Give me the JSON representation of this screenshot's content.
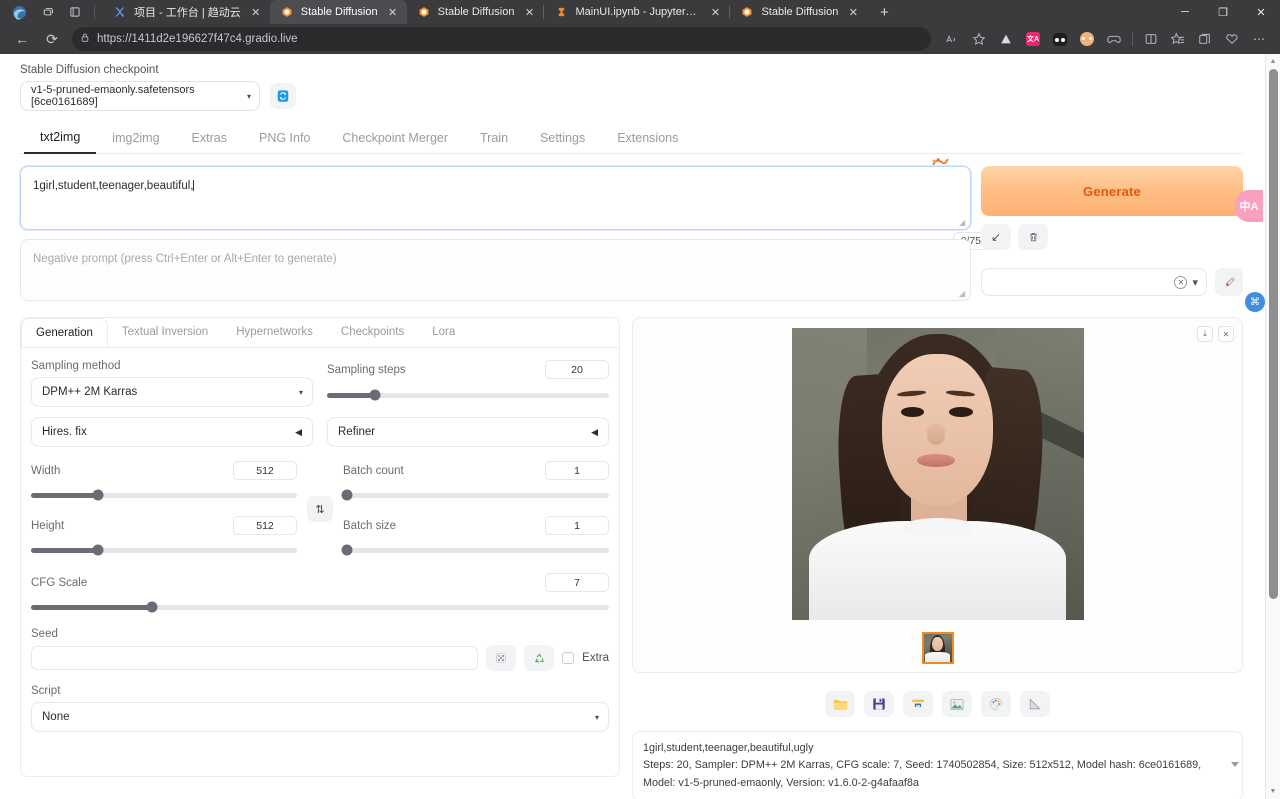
{
  "browser": {
    "tabs": [
      {
        "title": "项目 - 工作台 | 趋动云",
        "favicon": "x-logo-icon",
        "active": false
      },
      {
        "title": "Stable Diffusion",
        "favicon": "sd-icon",
        "active": true
      },
      {
        "title": "Stable Diffusion",
        "favicon": "sd-icon",
        "active": false
      },
      {
        "title": "MainUI.ipynb - JupyterLab",
        "favicon": "hourglass-icon",
        "active": false
      },
      {
        "title": "Stable Diffusion",
        "favicon": "sd-icon",
        "active": false
      }
    ],
    "tab_close_label": "✕",
    "new_tab_label": "+",
    "window_controls": {
      "minimize": "─",
      "maximize": "❐",
      "close": "✕"
    },
    "nav": {
      "back": "←",
      "reload": "⟳"
    },
    "address": {
      "lock": "🔒",
      "url": "https://1411d2e196627f47c4.gradio.live"
    },
    "toolbar_icons": [
      "read-aloud-icon",
      "favorite-star-icon",
      "split-screen-icon",
      "translate-icon",
      "panda-icon",
      "profile-icon",
      "games-icon",
      "split-pane-icon",
      "collections-icon",
      "browser-essentials-icon",
      "drop-favorites-icon",
      "more-options-icon"
    ]
  },
  "checkpoint": {
    "label": "Stable Diffusion checkpoint",
    "value": "v1-5-pruned-emaonly.safetensors [6ce0161689]",
    "caret": "▾",
    "refresh_icon": "🔄"
  },
  "main_tabs": [
    {
      "label": "txt2img",
      "active": true
    },
    {
      "label": "img2img",
      "active": false
    },
    {
      "label": "Extras",
      "active": false
    },
    {
      "label": "PNG Info",
      "active": false
    },
    {
      "label": "Checkpoint Merger",
      "active": false
    },
    {
      "label": "Train",
      "active": false
    },
    {
      "label": "Settings",
      "active": false
    },
    {
      "label": "Extensions",
      "active": false
    }
  ],
  "prompt": {
    "positive_value": "1girl,student,teenager,beautiful,",
    "negative_placeholder": "Negative prompt (press Ctrl+Enter or Alt+Enter to generate)",
    "token_counter": "0/75",
    "paint_icon": "🎨"
  },
  "actions": {
    "generate_label": "Generate",
    "arrow_button": "↙",
    "trash_button": "🗑",
    "styles_clear": "✕",
    "styles_caret": "▾",
    "brush_button": "🖌",
    "translate_badge": "中A",
    "blue_circle": "⌘"
  },
  "sub_tabs": [
    {
      "label": "Generation",
      "active": true
    },
    {
      "label": "Textual Inversion",
      "active": false
    },
    {
      "label": "Hypernetworks",
      "active": false
    },
    {
      "label": "Checkpoints",
      "active": false
    },
    {
      "label": "Lora",
      "active": false
    }
  ],
  "settings": {
    "sampling_method_label": "Sampling method",
    "sampling_method_value": "DPM++ 2M Karras",
    "sampling_steps_label": "Sampling steps",
    "sampling_steps_value": "20",
    "hires_fix_label": "Hires. fix",
    "refiner_label": "Refiner",
    "accordion_arrow": "◀",
    "width_label": "Width",
    "width_value": "512",
    "height_label": "Height",
    "height_value": "512",
    "batch_count_label": "Batch count",
    "batch_count_value": "1",
    "batch_size_label": "Batch size",
    "batch_size_value": "1",
    "cfg_scale_label": "CFG Scale",
    "cfg_scale_value": "7",
    "seed_label": "Seed",
    "seed_value": "",
    "seed_dice_icon": "🎲",
    "seed_recycle_icon": "♻",
    "extra_label": "Extra",
    "script_label": "Script",
    "script_value": "None",
    "script_caret": "▾",
    "swap_icon": "⇅"
  },
  "gallery": {
    "download_icon": "⤓",
    "close_icon": "✕",
    "tools": [
      {
        "name": "open-folder-icon",
        "glyph": "📁"
      },
      {
        "name": "save-icon",
        "glyph": "💾"
      },
      {
        "name": "save-zip-icon",
        "glyph": "🗃"
      },
      {
        "name": "send-to-img2img-icon",
        "glyph": "🖼"
      },
      {
        "name": "send-to-inpaint-icon",
        "glyph": "🎨"
      },
      {
        "name": "send-to-extras-icon",
        "glyph": "📐"
      }
    ]
  },
  "info": {
    "line1": "1girl,student,teenager,beautiful,ugly",
    "line2": "Steps: 20, Sampler: DPM++ 2M Karras, CFG scale: 7, Seed: 1740502854, Size: 512x512, Model hash: 6ce0161689, Model: v1-5-pruned-emaonly, Version: v1.6.0-2-g4afaaf8a"
  },
  "colors": {
    "generate_accent": "#e8570d",
    "thumb_border": "#f08a24",
    "translate_pink": "#f9a0c0",
    "blue": "#3f8fe0"
  }
}
